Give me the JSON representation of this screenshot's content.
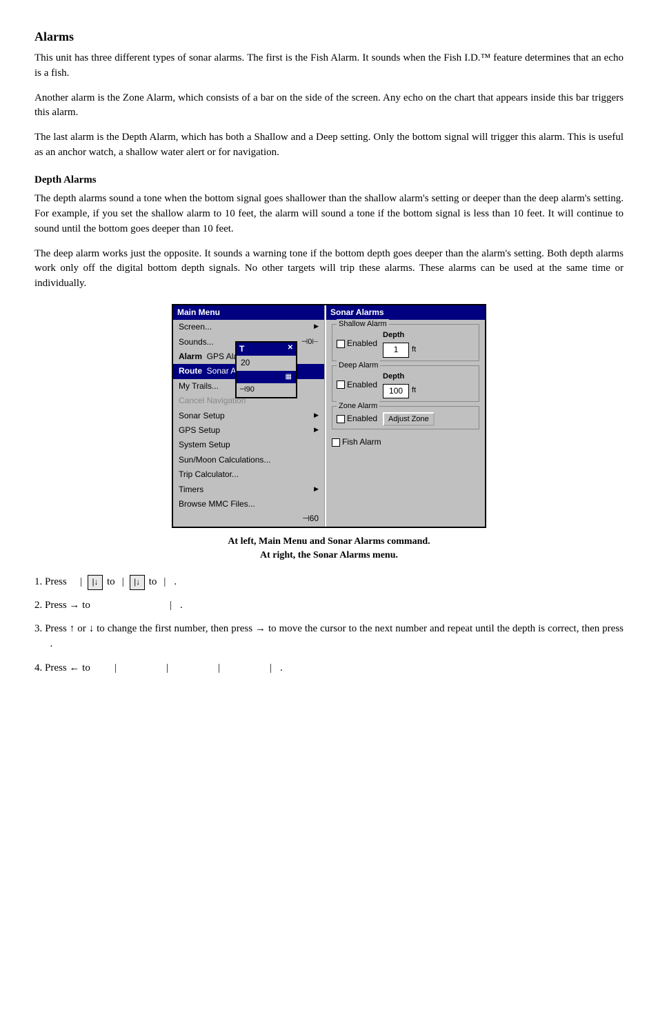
{
  "page": {
    "title": "Alarms",
    "subtitle": "Depth Alarms",
    "paragraphs": {
      "p1": "This unit has three different types of sonar alarms. The first is the Fish Alarm. It sounds when the Fish I.D.™ feature determines that an echo is a fish.",
      "p2": "Another alarm is the Zone Alarm, which consists of a bar on the side of the screen. Any echo on the chart that appears inside this bar triggers this alarm.",
      "p3": "The last alarm is the Depth Alarm, which has both a Shallow and a Deep setting. Only the bottom signal will trigger this alarm. This is useful as an anchor watch, a shallow water alert or for navigation.",
      "p4": "The depth alarms sound a tone when the bottom signal goes shallower than the shallow alarm's setting or deeper than the deep alarm's setting. For example, if you set the shallow alarm to 10 feet, the alarm will sound a tone if the bottom signal is less than 10 feet. It will continue to sound until the bottom goes deeper than 10 feet.",
      "p5": "The deep alarm works just the opposite. It sounds a warning tone if the bottom depth goes deeper than the alarm's setting. Both depth alarms work only off the digital bottom depth signals. No other targets will trip these alarms. These alarms can be used at the same time or individually."
    },
    "figure_caption_line1": "At left, Main Menu and Sonar Alarms command.",
    "figure_caption_line2": "At right, the Sonar Alarms menu.",
    "main_menu": {
      "title": "Main Menu",
      "items": [
        {
          "label": "Screen...",
          "has_arrow": true,
          "selected": false
        },
        {
          "label": "Sounds...",
          "has_arrow": false,
          "selected": false
        },
        {
          "label": "Alarm   GPS Alarms...",
          "has_arrow": false,
          "selected": false,
          "bold_prefix": "Alarm"
        },
        {
          "label": "Route  Sonar Alarms...",
          "has_arrow": false,
          "selected": true,
          "bold_prefix": "Route"
        },
        {
          "label": "My Trails...",
          "has_arrow": false,
          "selected": false
        },
        {
          "label": "Cancel Navigation",
          "has_arrow": false,
          "selected": false,
          "disabled": true
        },
        {
          "label": "Sonar Setup",
          "has_arrow": true,
          "selected": false
        },
        {
          "label": "GPS Setup",
          "has_arrow": true,
          "selected": false
        },
        {
          "label": "System Setup",
          "has_arrow": false,
          "selected": false
        },
        {
          "label": "Sun/Moon Calculations...",
          "has_arrow": false,
          "selected": false
        },
        {
          "label": "Trip Calculator...",
          "has_arrow": false,
          "selected": false
        },
        {
          "label": "Timers",
          "has_arrow": true,
          "selected": false
        },
        {
          "label": "Browse MMC Files...",
          "has_arrow": false,
          "selected": false
        }
      ]
    },
    "sonar_alarms": {
      "title": "Sonar Alarms",
      "shallow_alarm": {
        "label": "Shallow Alarm",
        "enabled": false,
        "depth_label": "Depth",
        "depth_value": "1",
        "unit": "ft"
      },
      "deep_alarm": {
        "label": "Deep Alarm",
        "enabled": false,
        "depth_label": "Depth",
        "depth_value": "100",
        "unit": "ft"
      },
      "zone_alarm": {
        "label": "Zone Alarm",
        "enabled": false,
        "adjust_label": "Adjust Zone"
      },
      "fish_alarm": {
        "label": "Fish Alarm",
        "enabled": false
      }
    },
    "steps": {
      "step1": {
        "num": "1. Press",
        "parts": [
          "| ↓ to",
          "| ↓ to",
          "|",
          "."
        ]
      },
      "step2": {
        "num": "2. Press → to",
        "parts": [
          "|",
          "."
        ]
      },
      "step3_text": "3. Press ↑ or ↓ to change the first number, then press → to move the cursor to the next number and repeat until the depth is correct, then press      .",
      "step4": {
        "num": "4. Press ← to",
        "parts": [
          "|",
          "|",
          "|",
          "|",
          "."
        ]
      }
    }
  }
}
